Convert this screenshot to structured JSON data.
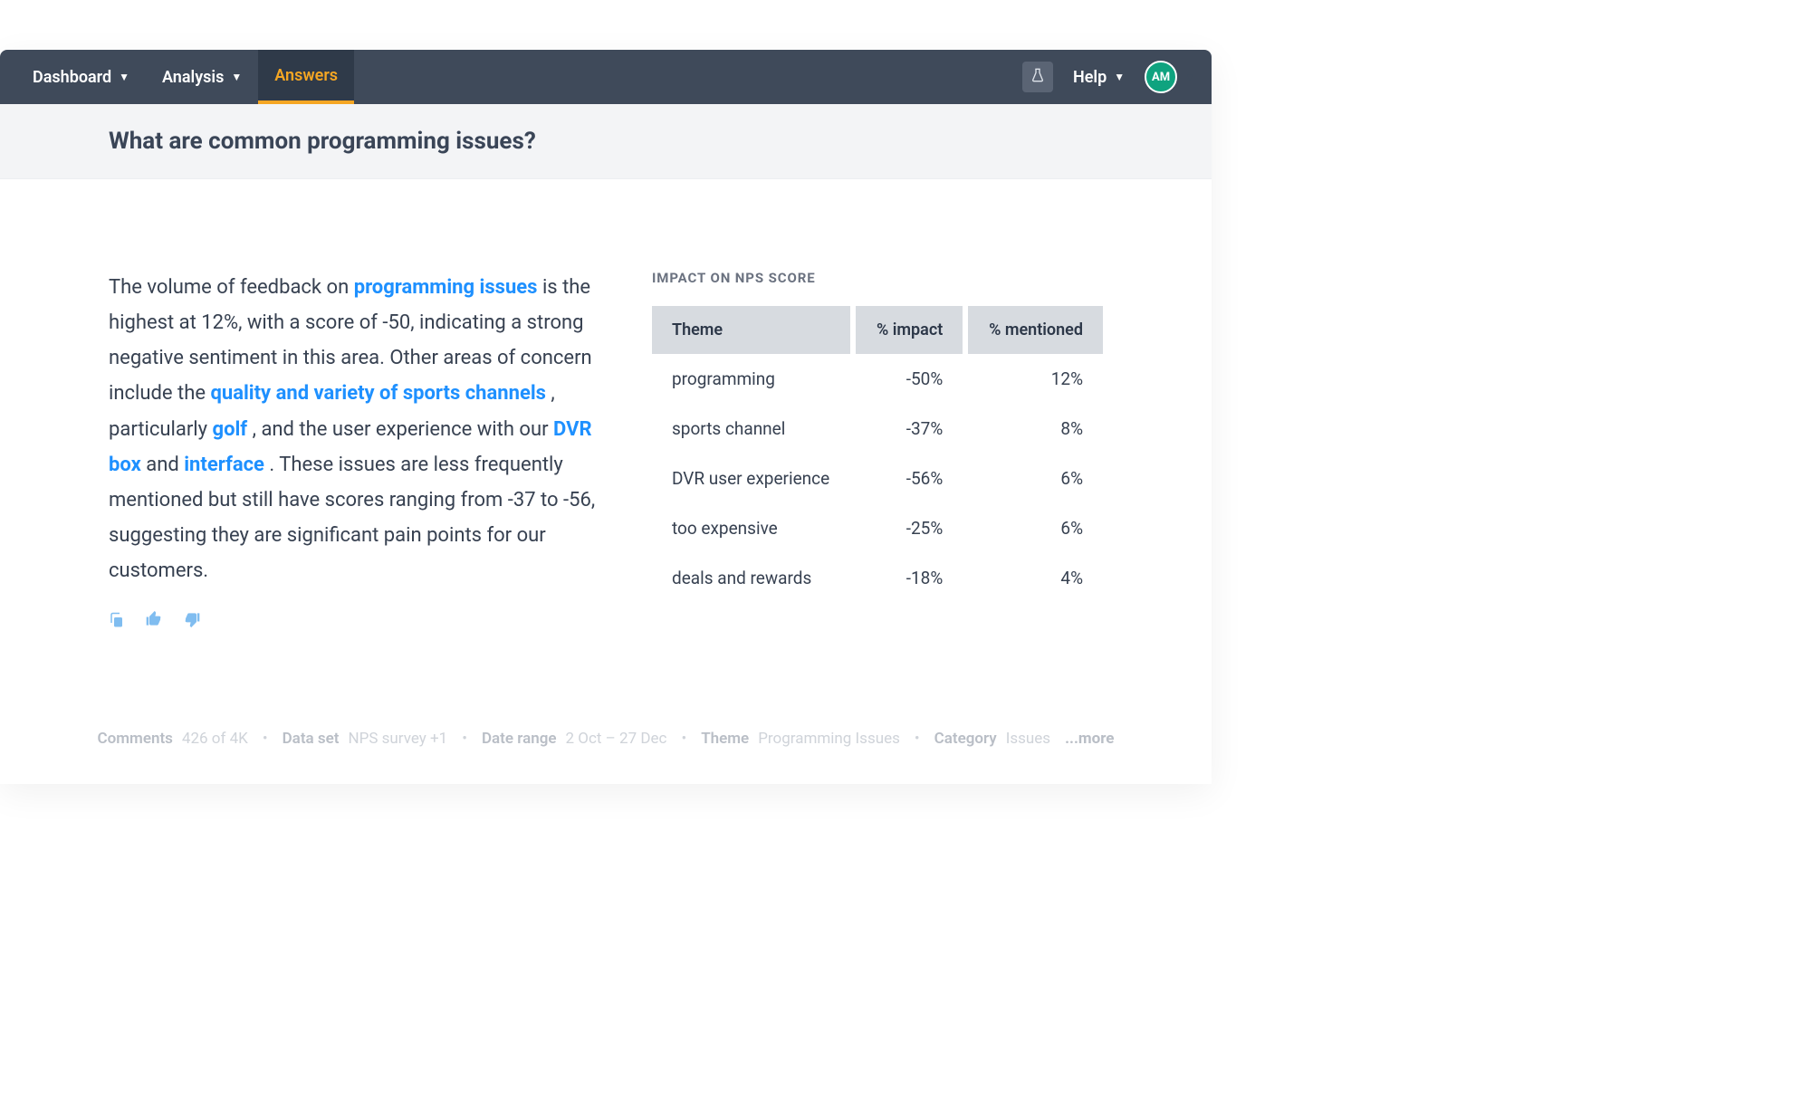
{
  "nav": {
    "items": [
      {
        "label": "Dashboard"
      },
      {
        "label": "Analysis"
      },
      {
        "label": "Answers"
      }
    ],
    "help_label": "Help",
    "avatar_initials": "AM"
  },
  "page": {
    "title": "What are common programming issues?"
  },
  "answer": {
    "seg0": "The volume of feedback on ",
    "link0": "programming issues",
    "seg1": " is the highest at 12%, with a score of -50, indicating a strong negative sentiment in this area. Other areas of concern include the ",
    "link1": "quality and variety of sports channels",
    "seg2": ", particularly ",
    "link2": "golf",
    "seg3": ", and the user experience with our ",
    "link3": "DVR box",
    "seg4": " and ",
    "link4": "interface",
    "seg5": ". These issues are less frequently mentioned but still have scores ranging from -37 to -56, suggesting they are significant pain points for our customers."
  },
  "panel": {
    "title": "IMPACT ON NPS SCORE",
    "columns": [
      "Theme",
      "% impact",
      "% mentioned"
    ],
    "rows": [
      {
        "theme": "programming",
        "impact": "-50%",
        "mentioned": "12%"
      },
      {
        "theme": "sports channel",
        "impact": "-37%",
        "mentioned": "8%"
      },
      {
        "theme": "DVR user experience",
        "impact": "-56%",
        "mentioned": "6%"
      },
      {
        "theme": "too expensive",
        "impact": "-25%",
        "mentioned": "6%"
      },
      {
        "theme": "deals and rewards",
        "impact": "-18%",
        "mentioned": "4%"
      }
    ]
  },
  "meta": {
    "comments_label": "Comments",
    "comments_value": "426 of 4K",
    "dataset_label": "Data set",
    "dataset_value": "NPS survey +1",
    "daterange_label": "Date range",
    "daterange_value": "2 Oct – 27 Dec",
    "theme_label": "Theme",
    "theme_value": "Programming Issues",
    "category_label": "Category",
    "category_value": "Issues",
    "more_label": "...more"
  }
}
